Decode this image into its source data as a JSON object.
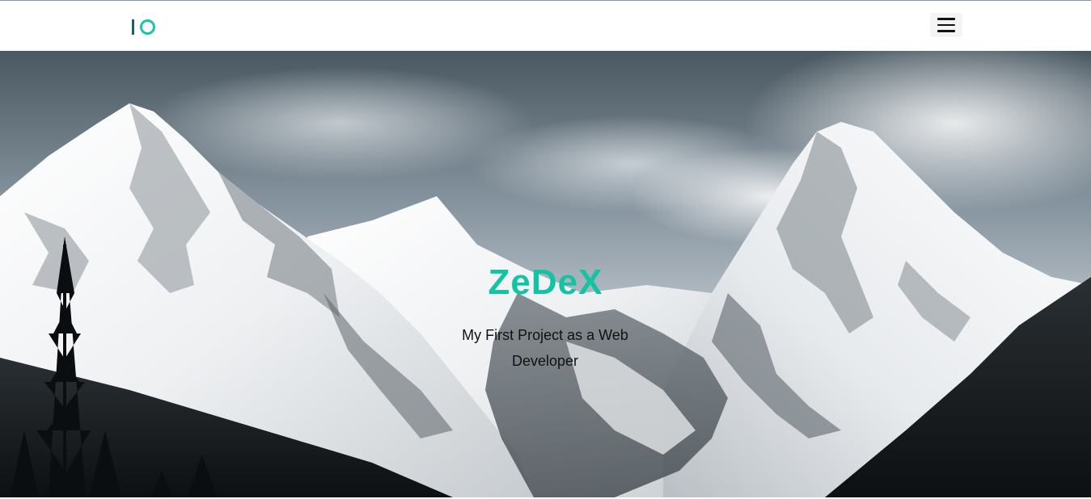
{
  "header": {
    "logo_icon": "io-logo",
    "menu_icon": "hamburger-menu-icon"
  },
  "hero": {
    "title": "ZeDeX",
    "subtitle": "My First Project as a Web Developer",
    "background": "snowy-mountains-photo"
  },
  "colors": {
    "accent": "#13c3a4",
    "logo_bar": "#1d5f6e",
    "subtitle_text": "#111111",
    "nav_background": "#ffffff"
  }
}
